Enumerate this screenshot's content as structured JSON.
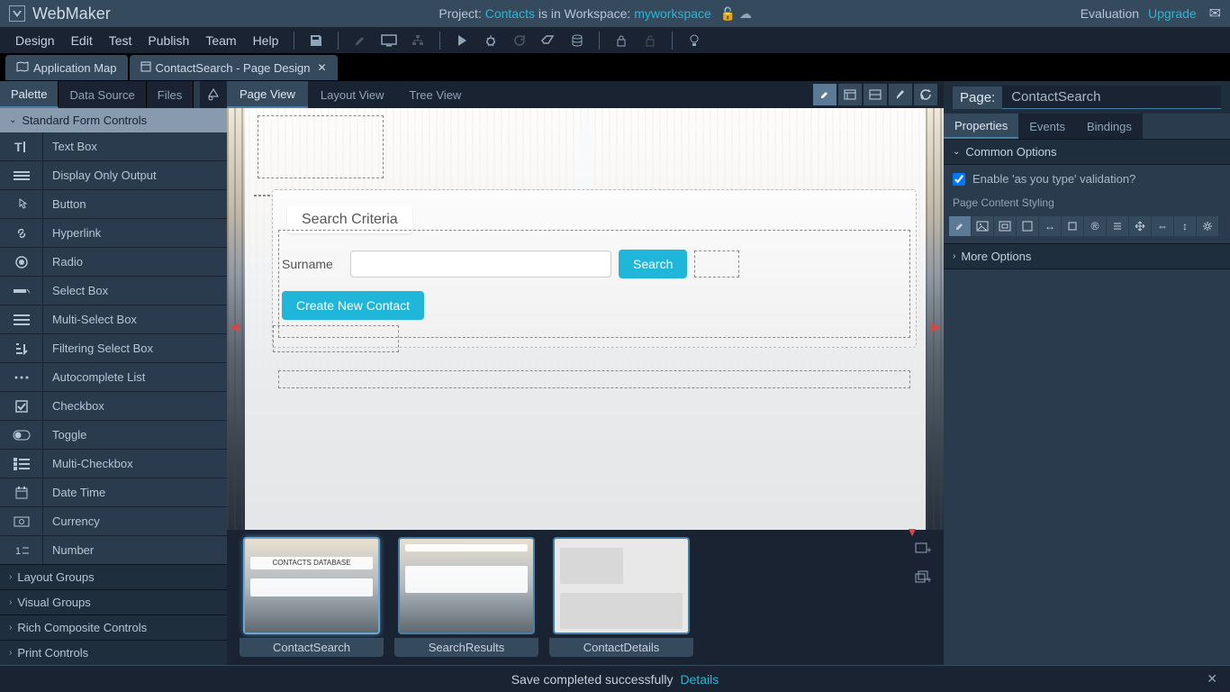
{
  "app": {
    "name": "WebMaker"
  },
  "project_bar": {
    "prefix": "Project: ",
    "project_name": "Contacts",
    "middle": " is in Workspace: ",
    "workspace_name": "myworkspace"
  },
  "header_right": {
    "eval": "Evaluation",
    "upgrade": "Upgrade"
  },
  "menus": {
    "design": "Design",
    "edit": "Edit",
    "test": "Test",
    "publish": "Publish",
    "team": "Team",
    "help": "Help"
  },
  "tabs": {
    "app_map": "Application Map",
    "page_tab": "ContactSearch - Page Design"
  },
  "left_tabs": {
    "palette": "Palette",
    "datasource": "Data Source",
    "files": "Files"
  },
  "palette": {
    "standard_header": "Standard Form Controls",
    "items": {
      "textbox": "Text Box",
      "display": "Display Only Output",
      "button": "Button",
      "hyperlink": "Hyperlink",
      "radio": "Radio",
      "select": "Select Box",
      "multiselect": "Multi-Select Box",
      "filterselect": "Filtering Select Box",
      "autocomplete": "Autocomplete List",
      "checkbox": "Checkbox",
      "toggle": "Toggle",
      "multicheck": "Multi-Checkbox",
      "datetime": "Date Time",
      "currency": "Currency",
      "number": "Number"
    },
    "footer": {
      "layout": "Layout Groups",
      "visual": "Visual Groups",
      "rich": "Rich Composite Controls",
      "print": "Print Controls"
    }
  },
  "center_tabs": {
    "page": "Page View",
    "layout": "Layout View",
    "tree": "Tree View"
  },
  "canvas": {
    "search_title": "Search Criteria",
    "surname_label": "Surname",
    "search_btn": "Search",
    "create_btn": "Create New Contact"
  },
  "thumbs": {
    "t1": "ContactSearch",
    "t1_title": "CONTACTS DATABASE",
    "t2": "SearchResults",
    "t3": "ContactDetails"
  },
  "right": {
    "page_label": "Page:",
    "page_name": "ContactSearch",
    "tabs": {
      "properties": "Properties",
      "events": "Events",
      "bindings": "Bindings"
    },
    "common_options": "Common Options",
    "validation_label": "Enable 'as you type' validation?",
    "styling_label": "Page Content Styling",
    "more_options": "More Options"
  },
  "status": {
    "msg": "Save completed successfully",
    "details": "Details"
  }
}
